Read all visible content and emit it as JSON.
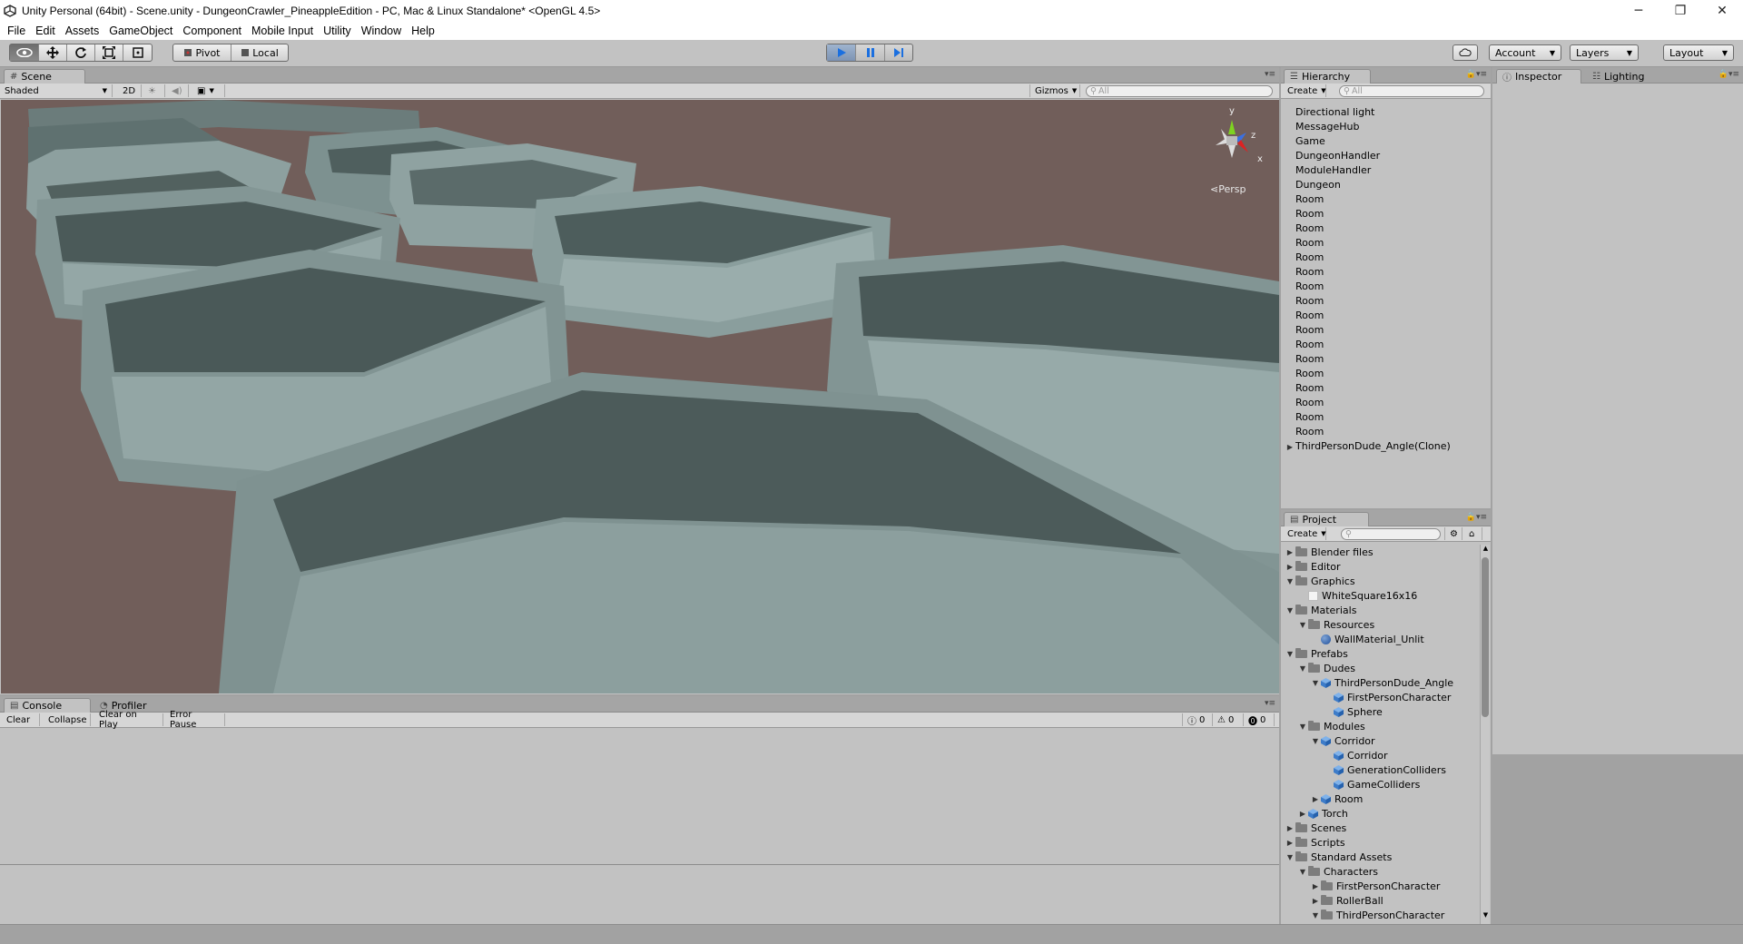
{
  "window": {
    "title": "Unity Personal (64bit) - Scene.unity - DungeonCrawler_PineappleEdition - PC, Mac & Linux Standalone* <OpenGL 4.5>",
    "minimize": "─",
    "restore": "❐",
    "close": "✕"
  },
  "menu": [
    "File",
    "Edit",
    "Assets",
    "GameObject",
    "Component",
    "Mobile Input",
    "Utility",
    "Window",
    "Help"
  ],
  "toolbar": {
    "pivot_label": "Pivot",
    "local_label": "Local",
    "account_label": "Account",
    "layers_label": "Layers",
    "layout_label": "Layout"
  },
  "scene": {
    "tab_label": "Scene",
    "shading_mode": "Shaded",
    "mode_2d": "2D",
    "gizmos_label": "Gizmos",
    "search_placeholder": "All",
    "persp_label": "Persp",
    "axis_y": "y",
    "axis_x": "x",
    "axis_z": "z"
  },
  "hierarchy": {
    "tab_label": "Hierarchy",
    "create_label": "Create",
    "search_placeholder": "All",
    "items": [
      "Directional light",
      "MessageHub",
      "Game",
      "DungeonHandler",
      "ModuleHandler",
      "Dungeon",
      "Room",
      "Room",
      "Room",
      "Room",
      "Room",
      "Room",
      "Room",
      "Room",
      "Room",
      "Room",
      "Room",
      "Room",
      "Room",
      "Room",
      "Room",
      "Room",
      "Room",
      "ThirdPersonDude_Angle(Clone)"
    ]
  },
  "inspector": {
    "tab_label": "Inspector",
    "lighting_tab_label": "Lighting"
  },
  "project": {
    "tab_label": "Project",
    "create_label": "Create",
    "items": [
      {
        "label": "Blender files",
        "icon": "folder",
        "depth": 0,
        "arrow": "right"
      },
      {
        "label": "Editor",
        "icon": "folder",
        "depth": 0,
        "arrow": "right"
      },
      {
        "label": "Graphics",
        "icon": "folder",
        "depth": 0,
        "arrow": "down"
      },
      {
        "label": "WhiteSquare16x16",
        "icon": "texture",
        "depth": 1,
        "arrow": ""
      },
      {
        "label": "Materials",
        "icon": "folder",
        "depth": 0,
        "arrow": "down"
      },
      {
        "label": "Resources",
        "icon": "folder",
        "depth": 1,
        "arrow": "down"
      },
      {
        "label": "WallMaterial_Unlit",
        "icon": "material",
        "depth": 2,
        "arrow": ""
      },
      {
        "label": "Prefabs",
        "icon": "folder",
        "depth": 0,
        "arrow": "down"
      },
      {
        "label": "Dudes",
        "icon": "folder",
        "depth": 1,
        "arrow": "down"
      },
      {
        "label": "ThirdPersonDude_Angle",
        "icon": "prefab",
        "depth": 2,
        "arrow": "down"
      },
      {
        "label": "FirstPersonCharacter",
        "icon": "prefab",
        "depth": 3,
        "arrow": ""
      },
      {
        "label": "Sphere",
        "icon": "prefab",
        "depth": 3,
        "arrow": ""
      },
      {
        "label": "Modules",
        "icon": "folder",
        "depth": 1,
        "arrow": "down"
      },
      {
        "label": "Corridor",
        "icon": "prefab",
        "depth": 2,
        "arrow": "down"
      },
      {
        "label": "Corridor",
        "icon": "prefab",
        "depth": 3,
        "arrow": ""
      },
      {
        "label": "GenerationColliders",
        "icon": "prefab",
        "depth": 3,
        "arrow": ""
      },
      {
        "label": "GameColliders",
        "icon": "prefab",
        "depth": 3,
        "arrow": ""
      },
      {
        "label": "Room",
        "icon": "prefab",
        "depth": 2,
        "arrow": "right"
      },
      {
        "label": "Torch",
        "icon": "prefab",
        "depth": 1,
        "arrow": "right"
      },
      {
        "label": "Scenes",
        "icon": "folder",
        "depth": 0,
        "arrow": "right"
      },
      {
        "label": "Scripts",
        "icon": "folder",
        "depth": 0,
        "arrow": "right"
      },
      {
        "label": "Standard Assets",
        "icon": "folder",
        "depth": 0,
        "arrow": "down"
      },
      {
        "label": "Characters",
        "icon": "folder",
        "depth": 1,
        "arrow": "down"
      },
      {
        "label": "FirstPersonCharacter",
        "icon": "folder",
        "depth": 2,
        "arrow": "right"
      },
      {
        "label": "RollerBall",
        "icon": "folder",
        "depth": 2,
        "arrow": "right"
      },
      {
        "label": "ThirdPersonCharacter",
        "icon": "folder",
        "depth": 2,
        "arrow": "down"
      }
    ]
  },
  "console": {
    "tab_label": "Console",
    "profiler_tab_label": "Profiler",
    "clear_label": "Clear",
    "collapse_label": "Collapse",
    "clear_on_play_label": "Clear on Play",
    "error_pause_label": "Error Pause",
    "log_count": "0",
    "warn_count": "0",
    "error_count": "0"
  }
}
